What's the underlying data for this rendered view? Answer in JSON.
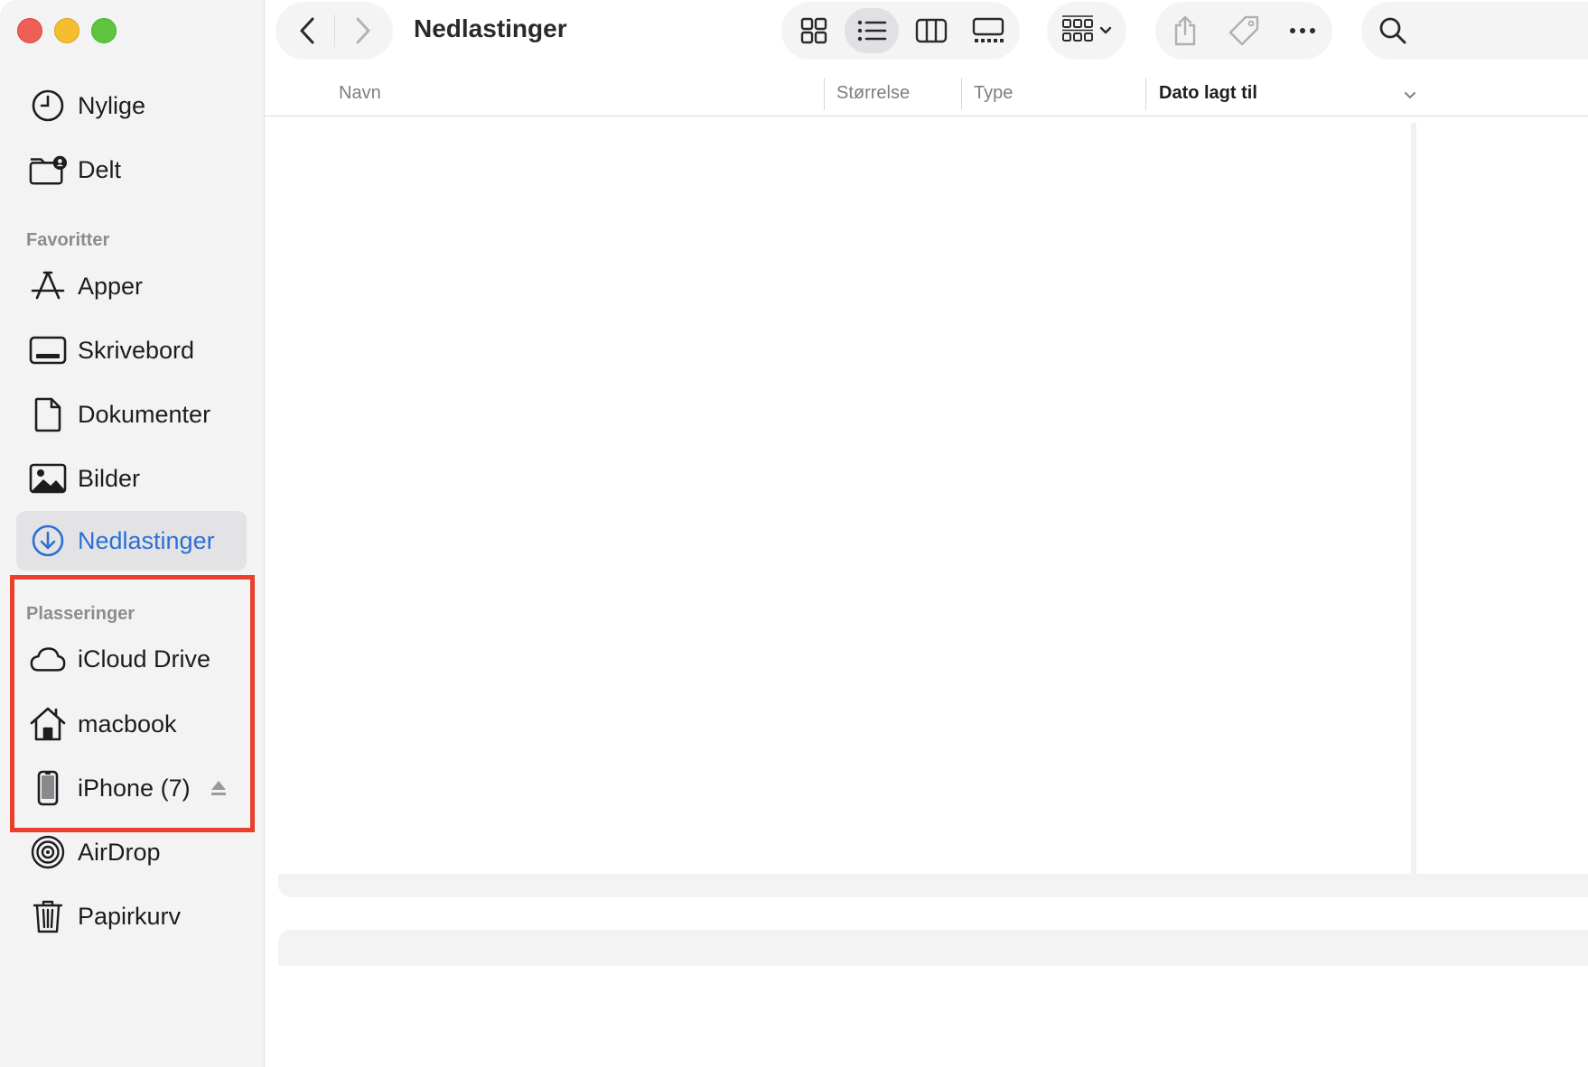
{
  "window": {
    "title": "Nedlastinger"
  },
  "colors": {
    "accent": "#2b6fd6",
    "highlight_border": "#e8402d"
  },
  "sidebar": {
    "top_items": [
      {
        "label": "Nylige",
        "icon": "clock-icon"
      },
      {
        "label": "Delt",
        "icon": "shared-folder-icon"
      }
    ],
    "favorites_header": "Favoritter",
    "favorites": [
      {
        "label": "Apper",
        "icon": "apps-icon"
      },
      {
        "label": "Skrivebord",
        "icon": "desktop-icon"
      },
      {
        "label": "Dokumenter",
        "icon": "document-icon"
      },
      {
        "label": "Bilder",
        "icon": "photo-icon"
      },
      {
        "label": "Nedlastinger",
        "icon": "download-icon",
        "active": true
      }
    ],
    "locations_header": "Plasseringer",
    "locations": [
      {
        "label": "iCloud Drive",
        "icon": "cloud-icon"
      },
      {
        "label": "macbook",
        "icon": "home-icon"
      },
      {
        "label": "iPhone (7)",
        "icon": "iphone-icon"
      }
    ],
    "other": [
      {
        "label": "AirDrop",
        "icon": "airdrop-icon"
      },
      {
        "label": "Papirkurv",
        "icon": "trash-icon"
      }
    ]
  },
  "toolbar": {
    "view_modes": [
      "icon-view-icon",
      "list-view-icon",
      "column-view-icon",
      "gallery-view-icon"
    ],
    "active_view": "list-view-icon"
  },
  "columns": {
    "name": "Navn",
    "size": "Størrelse",
    "type": "Type",
    "date_added": "Dato lagt til"
  }
}
